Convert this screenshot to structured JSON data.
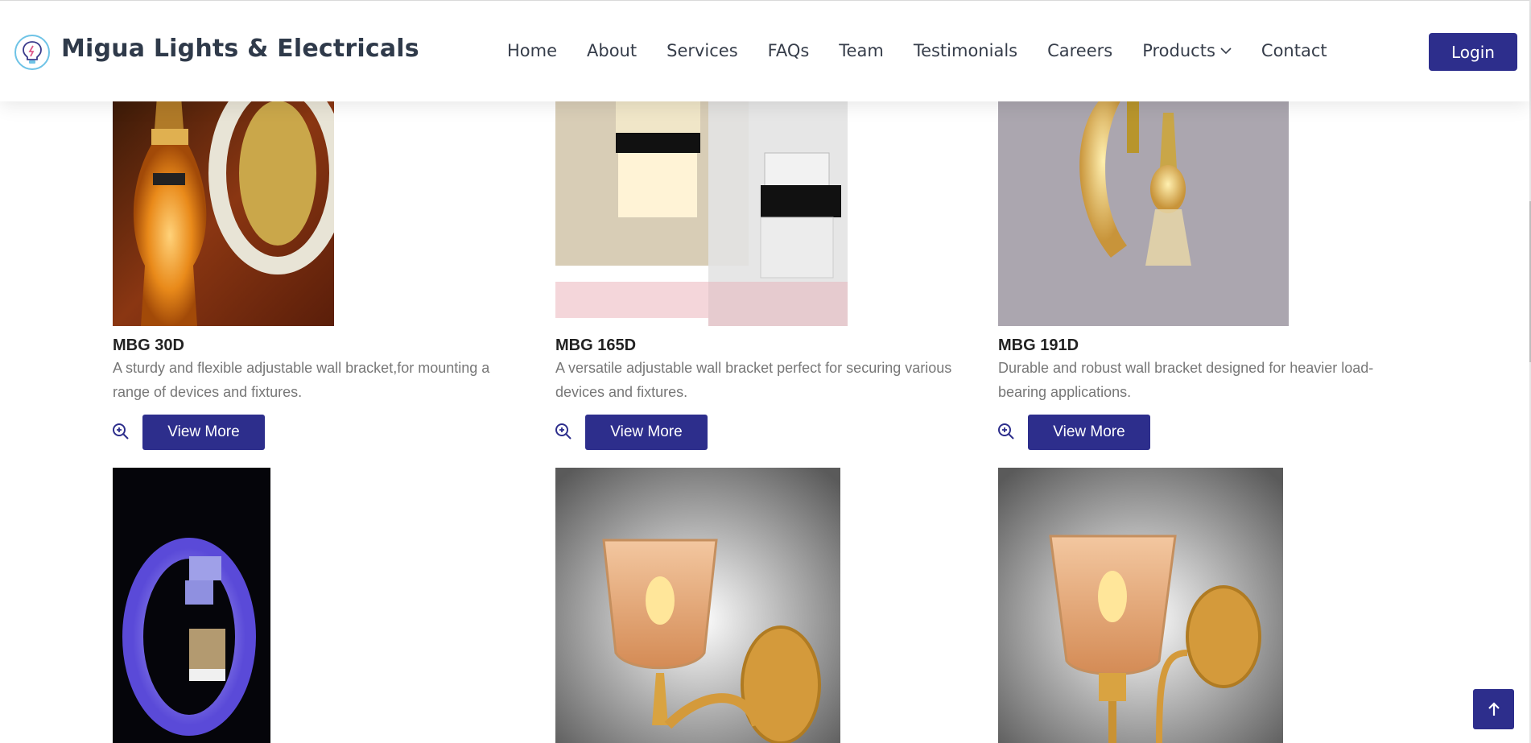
{
  "brand": {
    "name": "Migua Lights & Electricals",
    "logo_icon": "bulb-logo-icon"
  },
  "nav": {
    "items": [
      "Home",
      "About",
      "Services",
      "FAQs",
      "Team",
      "Testimonials",
      "Careers",
      "Products",
      "Contact"
    ],
    "login_label": "Login"
  },
  "products": [
    {
      "title": "MBG 30D",
      "desc_line1": "A sturdy and flexible adjustable wall bracket,for mounting a",
      "desc_line2": "range of devices and fixtures.",
      "button": "View More"
    },
    {
      "title": "MBG 165D",
      "desc_line1": "A versatile adjustable wall bracket perfect for securing various",
      "desc_line2": "devices and fixtures.",
      "button": "View More"
    },
    {
      "title": "MBG 191D",
      "desc_line1": "Durable and robust wall bracket designed for heavier load-",
      "desc_line2": "bearing applications.",
      "button": "View More"
    }
  ],
  "colors": {
    "accent": "#2d2e8c",
    "text_dark": "#2f3a4a",
    "text_muted": "#777777"
  }
}
